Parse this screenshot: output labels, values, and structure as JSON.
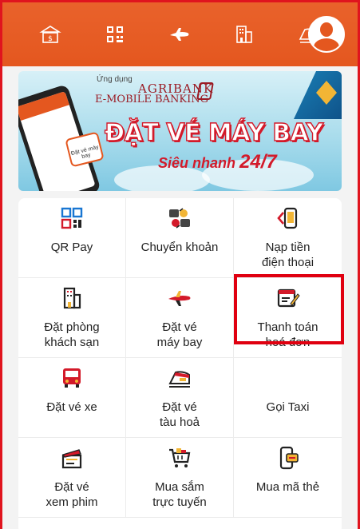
{
  "topbar": {
    "icons": [
      "bank-transfer-icon",
      "qr-code-icon",
      "airplane-icon",
      "hotel-icon",
      "train-icon"
    ],
    "accent": "#e4571f"
  },
  "banner": {
    "app_sub": "Ứng dụng",
    "brand_line1": "AGRIBANK",
    "brand_line2": "E-MOBILE BANKING",
    "headline": "ĐẶT VÉ MÁY BAY",
    "tagline_prefix": "Siêu nhanh ",
    "tagline_suffix": "24/7",
    "card_text": "Đặt vé máy bay"
  },
  "services": [
    {
      "label": "QR Pay",
      "icon": "qr-pay-icon"
    },
    {
      "label": "Chuyển khoản",
      "icon": "money-transfer-icon"
    },
    {
      "label": "Nạp tiền\nđiện thoại",
      "icon": "phone-topup-icon"
    },
    {
      "label": "Đặt phòng\nkhách sạn",
      "icon": "hotel-icon"
    },
    {
      "label": "Đặt vé\nmáy bay",
      "icon": "airplane-icon"
    },
    {
      "label": "Thanh toán\nhoá đơn",
      "icon": "bill-payment-icon"
    },
    {
      "label": "Đặt vé xe",
      "icon": "bus-icon"
    },
    {
      "label": "Đặt vé\ntàu hoả",
      "icon": "train-icon"
    },
    {
      "label": "Gọi Taxi",
      "icon": "taxi-icon"
    },
    {
      "label": "Đặt vé\nxem phim",
      "icon": "movie-clapper-icon"
    },
    {
      "label": "Mua sắm\ntrực tuyến",
      "icon": "shopping-cart-icon"
    },
    {
      "label": "Mua mã thẻ",
      "icon": "card-code-icon"
    }
  ],
  "highlight": {
    "service": "Thanh toán\nhoá đơn",
    "color": "#e00010"
  }
}
